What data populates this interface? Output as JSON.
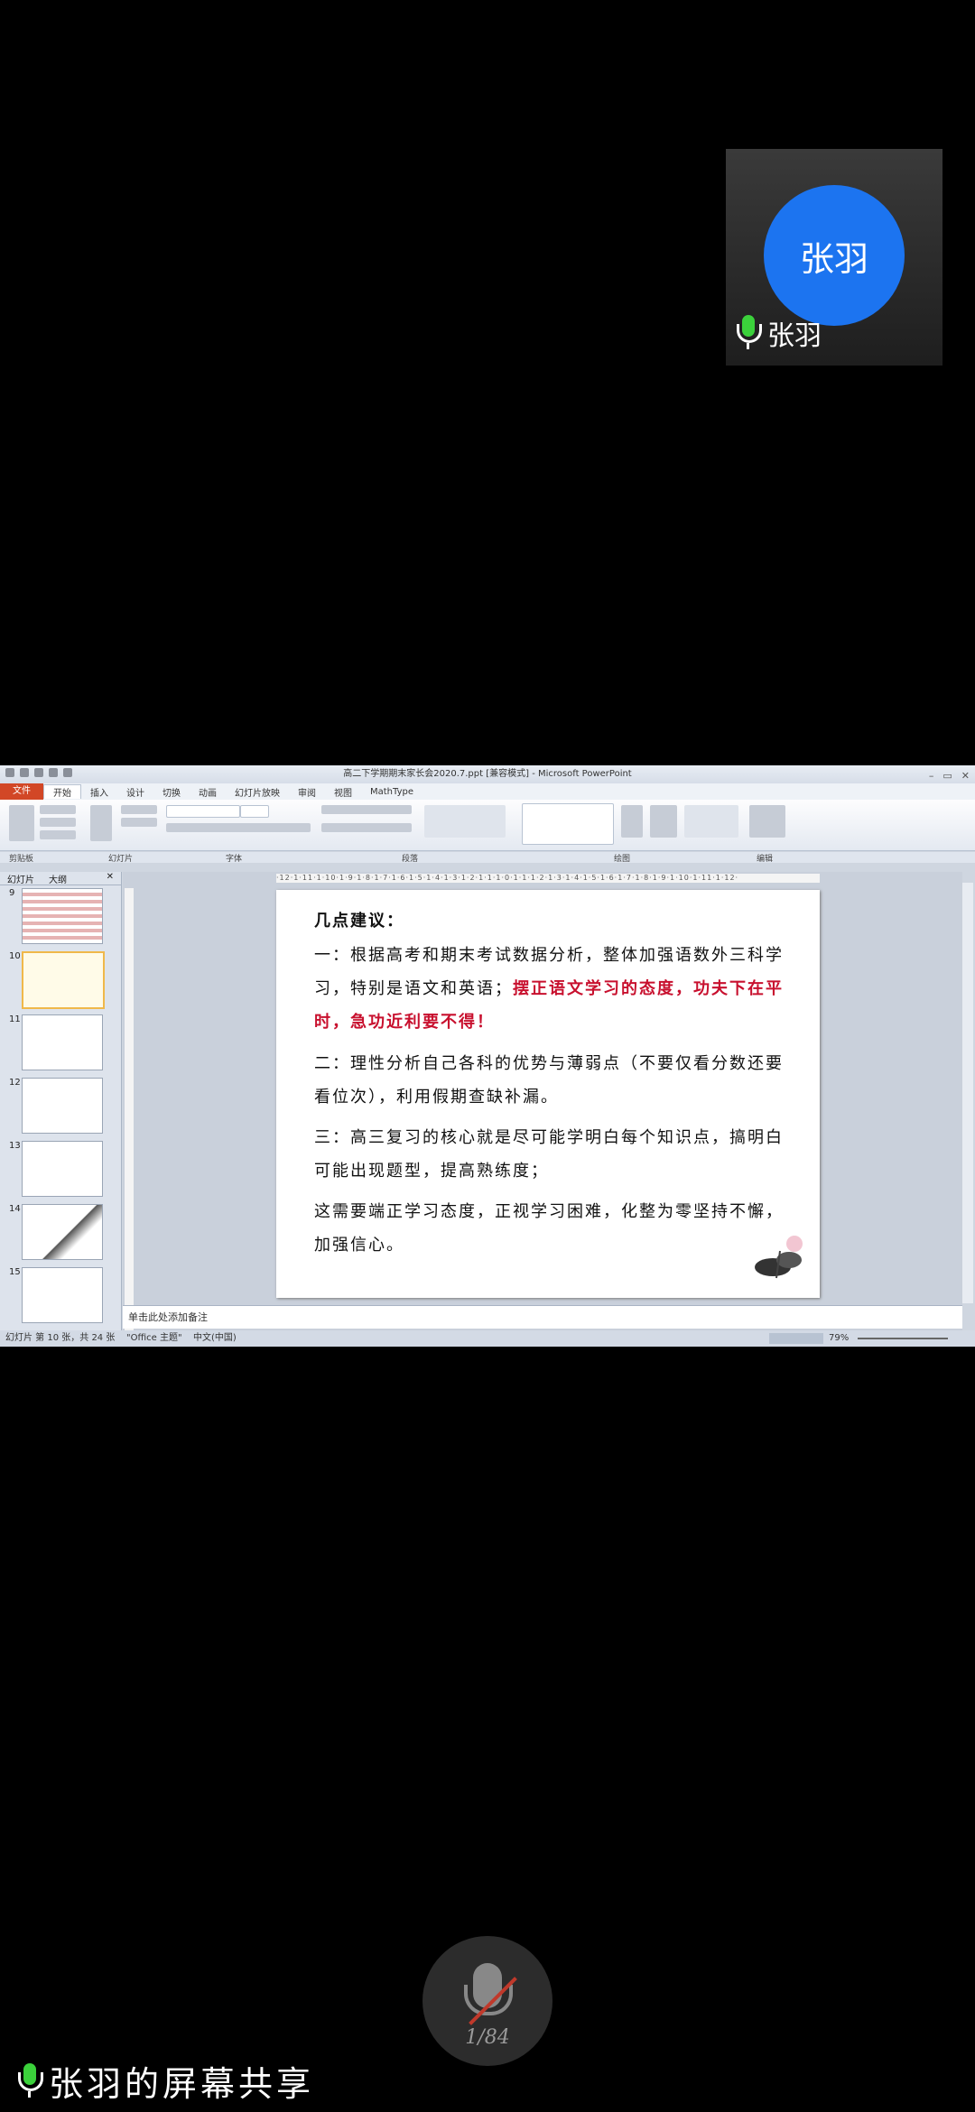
{
  "participant": {
    "avatar_text": "张羽",
    "name": "张羽"
  },
  "ppt": {
    "title": "高二下学期期末家长会2020.7.ppt [兼容模式] - Microsoft PowerPoint",
    "menu": [
      "文件",
      "开始",
      "插入",
      "设计",
      "切换",
      "动画",
      "幻灯片放映",
      "审阅",
      "视图",
      "MathType"
    ],
    "groups": [
      "剪贴板",
      "幻灯片",
      "字体",
      "段落",
      "绘图",
      "编辑"
    ],
    "panel_tabs": [
      "幻灯片",
      "大纲"
    ],
    "thumb_numbers": [
      "9",
      "10",
      "11",
      "12",
      "13",
      "14",
      "15"
    ],
    "ruler": "·12·1·11·1·10·1·9·1·8·1·7·1·6·1·5·1·4·1·3·1·2·1·1·1·0·1·1·1·2·1·3·1·4·1·5·1·6·1·7·1·8·1·9·1·10·1·11·1·12·",
    "slide": {
      "heading": "几点建议：",
      "p1_a": "一：根据高考和期末考试数据分析，整体加强语数外三科学习，特别是语文和英语；",
      "p1_b": "摆正语文学习的态度，功夫下在平时，急功近利要不得！",
      "p2": "二：理性分析自己各科的优势与薄弱点（不要仅看分数还要看位次），利用假期查缺补漏。",
      "p3": "三：高三复习的核心就是尽可能学明白每个知识点，搞明白可能出现题型，提高熟练度；",
      "p4": "这需要端正学习态度，正视学习困难，化整为零坚持不懈，加强信心。"
    },
    "notes_placeholder": "单击此处添加备注",
    "status": {
      "slide": "幻灯片 第 10 张，共 24 张",
      "theme": "\"Office 主题\"",
      "lang": "中文(中国)",
      "zoom": "79%"
    }
  },
  "mic": {
    "count": "1/84"
  },
  "share_label": "张羽的屏幕共享",
  "colors": {
    "avatar": "#1c74f0",
    "accent_red": "#c8102e",
    "file_tab": "#d24726"
  }
}
